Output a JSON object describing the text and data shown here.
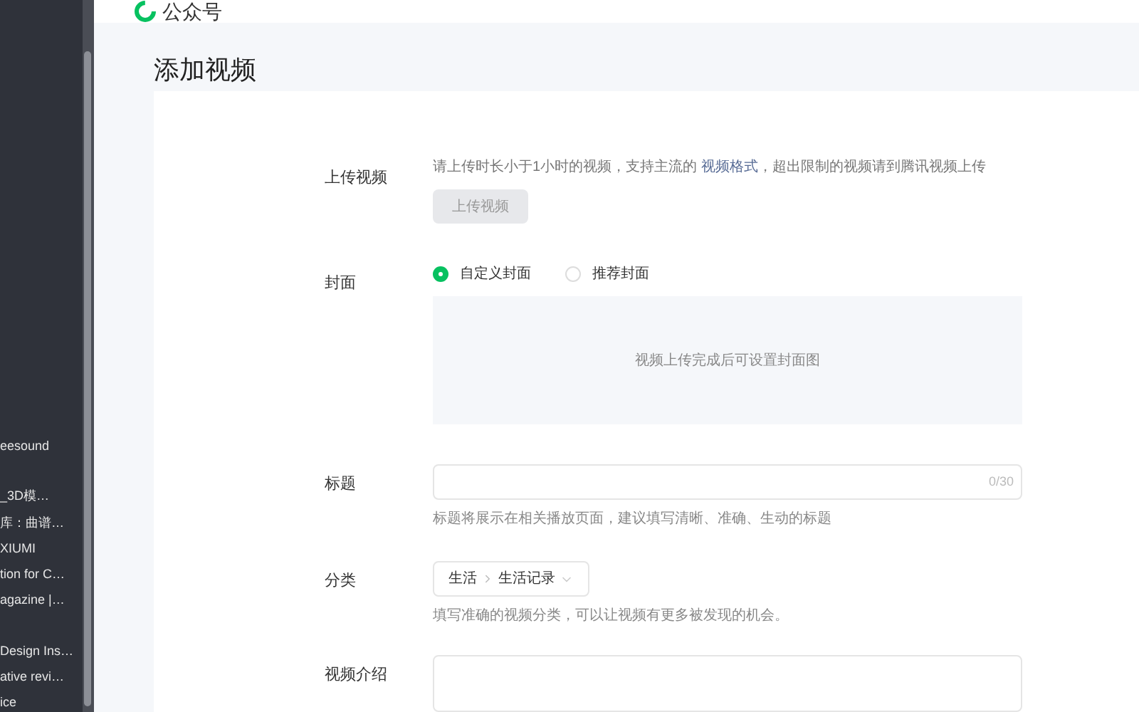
{
  "sidebar": {
    "items": [
      "eesound",
      "_3D模…",
      "库：曲谱…",
      "XIUMI",
      "tion for C…",
      "agazine |…",
      "Design Ins…",
      "ative revi…",
      "ice"
    ]
  },
  "header": {
    "brand": "公众号"
  },
  "page_title": "添加视频",
  "form": {
    "upload": {
      "label": "上传视频",
      "hint_before": "请上传时长小于1小时的视频，支持主流的",
      "link": "视频格式",
      "hint_after": "，超出限制的视频请到腾讯视频上传",
      "button": "上传视频"
    },
    "cover": {
      "label": "封面",
      "options": [
        {
          "label": "自定义封面",
          "selected": true
        },
        {
          "label": "推荐封面",
          "selected": false
        }
      ],
      "placeholder_text": "视频上传完成后可设置封面图"
    },
    "title": {
      "label": "标题",
      "counter": "0/30",
      "help": "标题将展示在相关播放页面，建议填写清晰、准确、生动的标题"
    },
    "category": {
      "label": "分类",
      "path": [
        "生活",
        "生活记录"
      ],
      "help": "填写准确的视频分类，可以让视频有更多被发现的机会。"
    },
    "intro": {
      "label": "视频介绍"
    }
  }
}
